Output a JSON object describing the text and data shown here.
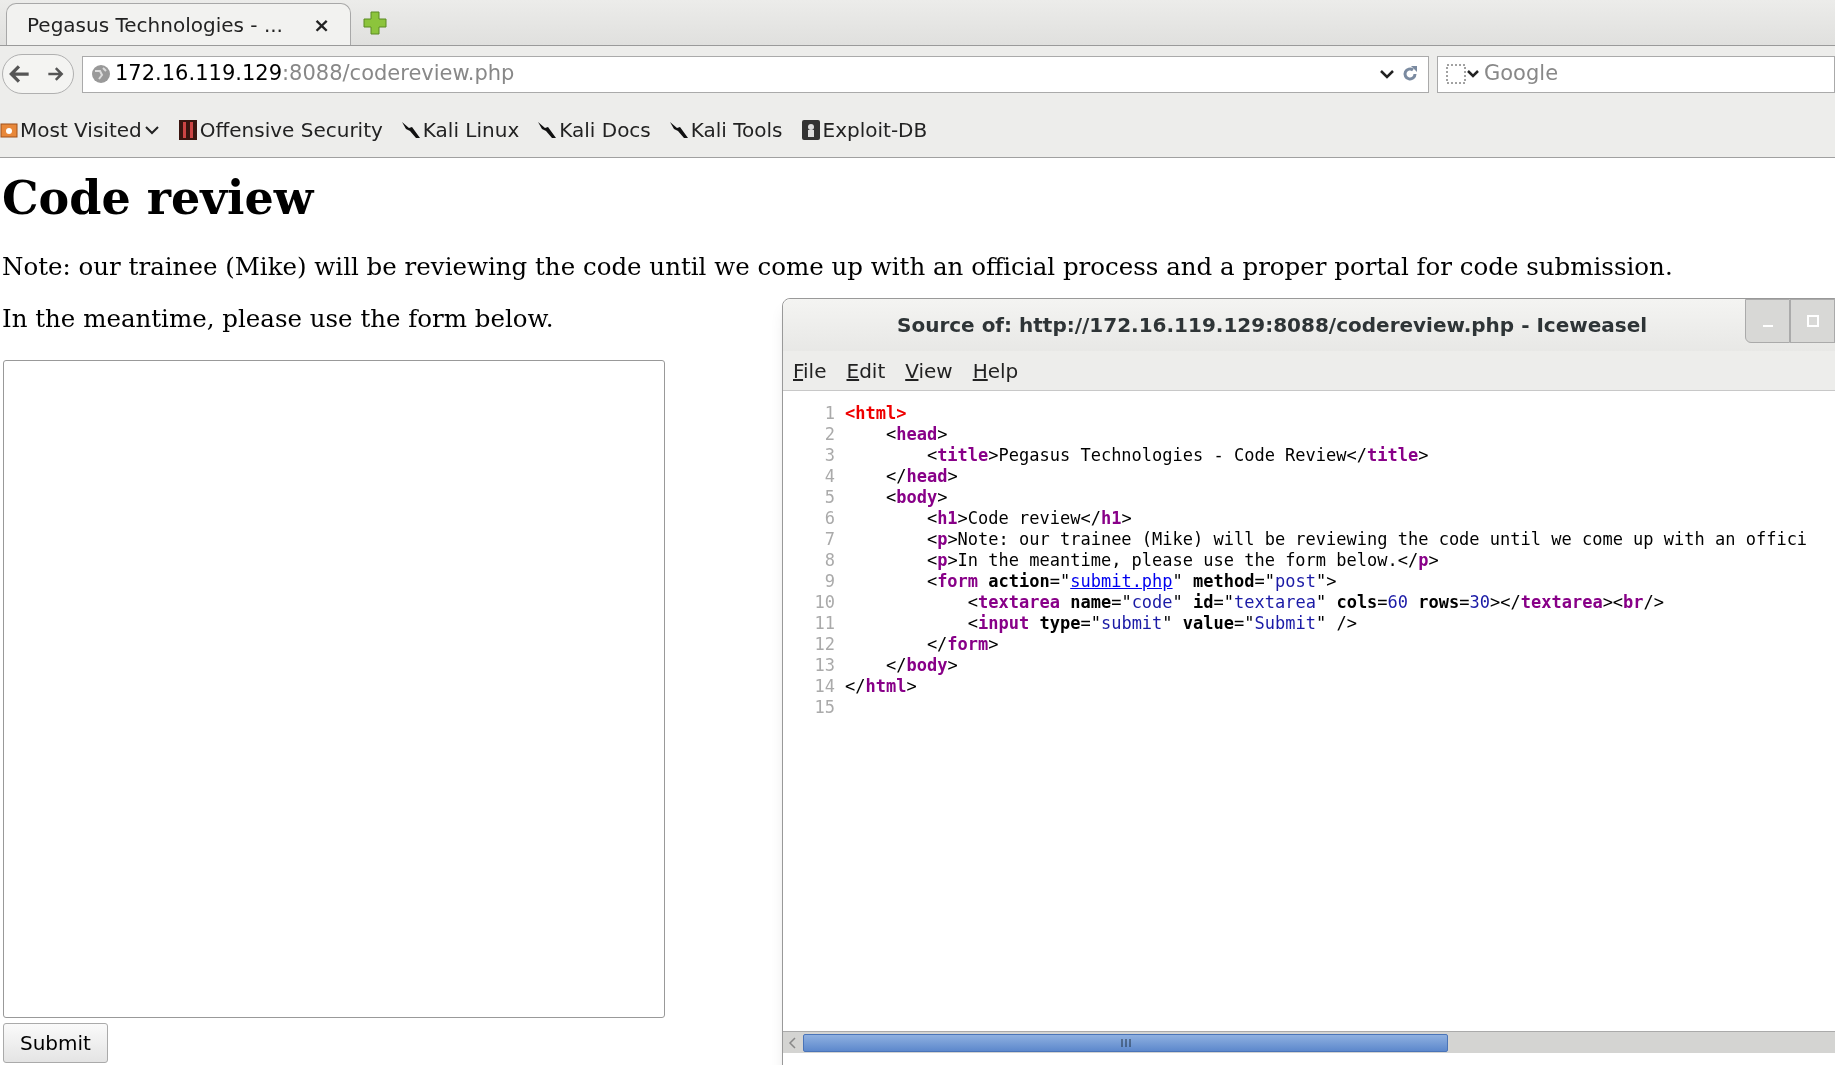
{
  "browser": {
    "tab": {
      "title": "Pegasus Technologies - ...",
      "close": "×"
    },
    "address": {
      "host": "172.16.119.129",
      "rest": ":8088/codereview.php"
    },
    "search": {
      "placeholder": "Google"
    },
    "bookmarks": [
      {
        "label": "Most Visited",
        "kind": "folder"
      },
      {
        "label": "Offensive Security",
        "kind": "site"
      },
      {
        "label": "Kali Linux",
        "kind": "kali"
      },
      {
        "label": "Kali Docs",
        "kind": "kali"
      },
      {
        "label": "Kali Tools",
        "kind": "kali"
      },
      {
        "label": "Exploit-DB",
        "kind": "exploit"
      }
    ]
  },
  "page": {
    "heading": "Code review",
    "paragraphs": [
      "Note: our trainee (Mike) will be reviewing the code until we come up with an official process and a proper portal for code submission.",
      "In the meantime, please use the form below."
    ],
    "submit": "Submit"
  },
  "source_window": {
    "title": "Source of: http://172.16.119.129:8088/codereview.php - Iceweasel",
    "menu": [
      "File",
      "Edit",
      "View",
      "Help"
    ],
    "lines": [
      {
        "number": "1",
        "tokens": [
          {
            "kind": "r",
            "text": "<html>"
          }
        ]
      },
      {
        "number": "2",
        "tokens": [
          {
            "kind": "p",
            "text": "    <"
          },
          {
            "kind": "t",
            "text": "head"
          },
          {
            "kind": "p",
            "text": ">"
          }
        ]
      },
      {
        "number": "3",
        "tokens": [
          {
            "kind": "p",
            "text": "        <"
          },
          {
            "kind": "t",
            "text": "title"
          },
          {
            "kind": "p",
            "text": ">Pegasus Technologies - Code Review</"
          },
          {
            "kind": "t",
            "text": "title"
          },
          {
            "kind": "p",
            "text": ">"
          }
        ]
      },
      {
        "number": "4",
        "tokens": [
          {
            "kind": "p",
            "text": "    </"
          },
          {
            "kind": "t",
            "text": "head"
          },
          {
            "kind": "p",
            "text": ">"
          }
        ]
      },
      {
        "number": "5",
        "tokens": [
          {
            "kind": "p",
            "text": "    <"
          },
          {
            "kind": "t",
            "text": "body"
          },
          {
            "kind": "p",
            "text": ">"
          }
        ]
      },
      {
        "number": "6",
        "tokens": [
          {
            "kind": "p",
            "text": "        <"
          },
          {
            "kind": "t",
            "text": "h1"
          },
          {
            "kind": "p",
            "text": ">Code review</"
          },
          {
            "kind": "t",
            "text": "h1"
          },
          {
            "kind": "p",
            "text": ">"
          }
        ]
      },
      {
        "number": "7",
        "tokens": [
          {
            "kind": "p",
            "text": "        <"
          },
          {
            "kind": "t",
            "text": "p"
          },
          {
            "kind": "p",
            "text": ">Note: our trainee (Mike) will be reviewing the code until we come up with an offici"
          }
        ]
      },
      {
        "number": "8",
        "tokens": [
          {
            "kind": "p",
            "text": "        <"
          },
          {
            "kind": "t",
            "text": "p"
          },
          {
            "kind": "p",
            "text": ">In the meantime, please use the form below.</"
          },
          {
            "kind": "t",
            "text": "p"
          },
          {
            "kind": "p",
            "text": ">"
          }
        ]
      },
      {
        "number": "9",
        "tokens": [
          {
            "kind": "p",
            "text": "        <"
          },
          {
            "kind": "t",
            "text": "form"
          },
          {
            "kind": "a",
            "text": " action"
          },
          {
            "kind": "p",
            "text": "=\""
          },
          {
            "kind": "l",
            "text": "submit.php"
          },
          {
            "kind": "p",
            "text": "\" "
          },
          {
            "kind": "a",
            "text": "method"
          },
          {
            "kind": "p",
            "text": "=\""
          },
          {
            "kind": "v",
            "text": "post"
          },
          {
            "kind": "p",
            "text": "\">"
          }
        ]
      },
      {
        "number": "10",
        "tokens": [
          {
            "kind": "p",
            "text": "            <"
          },
          {
            "kind": "t",
            "text": "textarea"
          },
          {
            "kind": "a",
            "text": " name"
          },
          {
            "kind": "p",
            "text": "=\""
          },
          {
            "kind": "v",
            "text": "code"
          },
          {
            "kind": "p",
            "text": "\" "
          },
          {
            "kind": "a",
            "text": "id"
          },
          {
            "kind": "p",
            "text": "=\""
          },
          {
            "kind": "v",
            "text": "textarea"
          },
          {
            "kind": "p",
            "text": "\" "
          },
          {
            "kind": "a",
            "text": "cols"
          },
          {
            "kind": "p",
            "text": "="
          },
          {
            "kind": "v",
            "text": "60"
          },
          {
            "kind": "a",
            "text": " rows"
          },
          {
            "kind": "p",
            "text": "="
          },
          {
            "kind": "v",
            "text": "30"
          },
          {
            "kind": "p",
            "text": "></"
          },
          {
            "kind": "t",
            "text": "textarea"
          },
          {
            "kind": "p",
            "text": "><"
          },
          {
            "kind": "t",
            "text": "br"
          },
          {
            "kind": "p",
            "text": "/>"
          }
        ]
      },
      {
        "number": "11",
        "tokens": [
          {
            "kind": "p",
            "text": "            <"
          },
          {
            "kind": "t",
            "text": "input"
          },
          {
            "kind": "a",
            "text": " type"
          },
          {
            "kind": "p",
            "text": "=\""
          },
          {
            "kind": "v",
            "text": "submit"
          },
          {
            "kind": "p",
            "text": "\" "
          },
          {
            "kind": "a",
            "text": "value"
          },
          {
            "kind": "p",
            "text": "=\""
          },
          {
            "kind": "v",
            "text": "Submit"
          },
          {
            "kind": "p",
            "text": "\" />"
          }
        ]
      },
      {
        "number": "12",
        "tokens": [
          {
            "kind": "p",
            "text": "        </"
          },
          {
            "kind": "t",
            "text": "form"
          },
          {
            "kind": "p",
            "text": ">"
          }
        ]
      },
      {
        "number": "13",
        "tokens": [
          {
            "kind": "p",
            "text": "    </"
          },
          {
            "kind": "t",
            "text": "body"
          },
          {
            "kind": "p",
            "text": ">"
          }
        ]
      },
      {
        "number": "14",
        "tokens": [
          {
            "kind": "p",
            "text": "</"
          },
          {
            "kind": "t",
            "text": "html"
          },
          {
            "kind": "p",
            "text": ">"
          }
        ]
      },
      {
        "number": "15"
      }
    ]
  }
}
